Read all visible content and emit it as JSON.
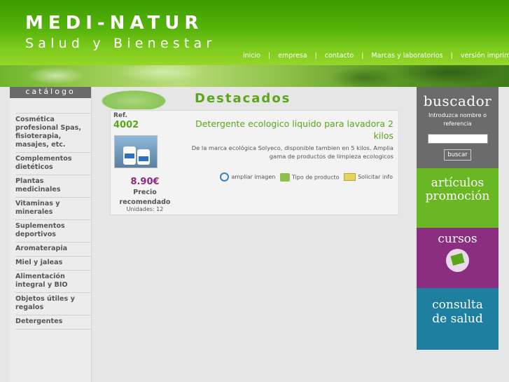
{
  "header": {
    "brand": "MEDI-NATUR",
    "tagline": "Salud y Bienestar",
    "nav": [
      "inicio",
      "empresa",
      "contacto",
      "Marcas y laboratorios",
      "versión imprimible"
    ]
  },
  "sidebar": {
    "title": "catálogo",
    "items": [
      "Cosmética profesional Spas, fisioterapia, masajes, etc.",
      "Complementos dietéticos",
      "Plantas medicinales",
      "Vitaminas y minerales",
      "Suplementos deportivos",
      "Aromaterapia",
      "Miel y jaleas",
      "Alimentación integral y BIO",
      "Objetos útiles y regalos",
      "Detergentes"
    ]
  },
  "main": {
    "section_title": "Destacados",
    "product": {
      "ref_label": "Ref.",
      "ref": "4002",
      "title": "Detergente ecologico liquido para lavadora 2 kilos",
      "description": "De la marca ecológica Solyeco, disponible tambien en 5 kilos. Amplia gama de productos de limpieza ecologicos",
      "price": "8.90€",
      "price_label": "Precio recomendado",
      "units": "Unidades: 12",
      "actions": {
        "zoom": "ampliar imagen",
        "type": "Tipo de producto",
        "request": "Solicitar info"
      }
    }
  },
  "right": {
    "search": {
      "title": "buscador",
      "hint": "Introduzca nombre o referencia",
      "input_value": "",
      "button": "buscar"
    },
    "promo": {
      "line1": "artículos",
      "line2": "promoción"
    },
    "cursos": {
      "title": "cursos"
    },
    "consulta": {
      "line1": "consulta",
      "line2": "de salud"
    }
  },
  "colors": {
    "brand_green": "#5aa61a",
    "price_purple": "#8a2a7e",
    "search_gray": "#6b6b6b",
    "promo_green": "#6ab724",
    "cursos_purple": "#8c2e7f",
    "consulta_blue": "#1e7fa1"
  }
}
